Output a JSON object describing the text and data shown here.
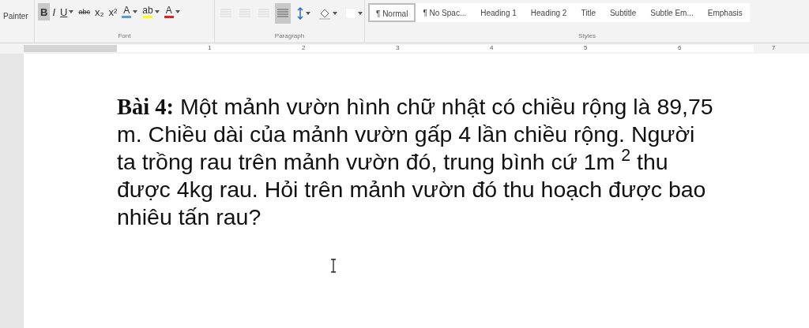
{
  "ribbon": {
    "clipboard": {
      "label": "Painter"
    },
    "font": {
      "group_label": "Font",
      "buttons": [
        {
          "kind": "text",
          "label": "B",
          "bold": true,
          "selected": true
        },
        {
          "kind": "text",
          "label": "I",
          "italic": true,
          "selected": false
        },
        {
          "kind": "text",
          "label": "U",
          "underline": true,
          "selected": false,
          "dropdown": true
        },
        {
          "kind": "text",
          "label": "abc",
          "strike": true,
          "selected": false
        },
        {
          "kind": "text",
          "label": "x₂",
          "selected": false
        },
        {
          "kind": "text",
          "label": "x²",
          "selected": false
        },
        {
          "kind": "color",
          "label": "A",
          "color": "#5b9bd5",
          "dropdown": true
        },
        {
          "kind": "color",
          "label": "ab",
          "color": "#ffff00",
          "dropdown": true
        },
        {
          "kind": "color",
          "label": "A",
          "color": "#e02020",
          "dropdown": true
        }
      ]
    },
    "paragraph": {
      "group_label": "Paragraph",
      "buttons": [
        {
          "kind": "align",
          "selected": false,
          "disabled": true
        },
        {
          "kind": "align",
          "selected": false,
          "disabled": true
        },
        {
          "kind": "align",
          "selected": false,
          "disabled": true
        },
        {
          "kind": "align",
          "selected": true,
          "disabled": false
        },
        {
          "kind": "spacing",
          "dropdown": true
        },
        {
          "kind": "shading",
          "dropdown": true
        },
        {
          "kind": "borders",
          "dropdown": true
        }
      ]
    },
    "styles": {
      "group_label": "Styles",
      "items": [
        {
          "label": "¶ Normal",
          "selected": true
        },
        {
          "label": "¶ No Spac...",
          "selected": false
        },
        {
          "label": "Heading 1",
          "selected": false
        },
        {
          "label": "Heading 2",
          "selected": false
        },
        {
          "label": "Title",
          "selected": false
        },
        {
          "label": "Subtitle",
          "selected": false
        },
        {
          "label": "Subtle Em...",
          "selected": false
        },
        {
          "label": "Emphasis",
          "selected": false
        }
      ]
    }
  },
  "ruler": {
    "numbers": [
      "1",
      "2",
      "3",
      "4",
      "5",
      "6",
      "7"
    ]
  },
  "document": {
    "paragraph": "**Bài 4:** Một mảnh vườn hình chữ nhật có chiều rộng là 89,75 m. Chiều dài của mảnh vườn gấp 4 lần chiều rộng. Người ta trồng rau trên mảnh vườn đó, trung bình cứ 1m $^{2}$ thu được 4kg rau. Hỏi trên mảnh vườn đó thu hoạch được bao nhiêu tấn rau?"
  }
}
